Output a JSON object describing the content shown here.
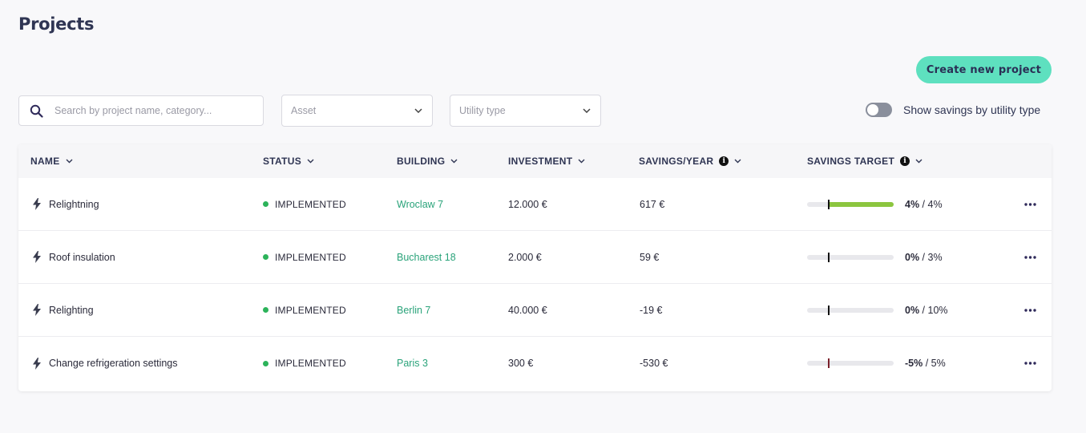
{
  "page": {
    "title": "Projects"
  },
  "toolbar": {
    "create_label": "Create new project",
    "search_placeholder": "Search by project name, category...",
    "asset_placeholder": "Asset",
    "utility_placeholder": "Utility type",
    "toggle_label": "Show savings by utility type",
    "toggle_on": false
  },
  "columns": {
    "name": "NAME",
    "status": "STATUS",
    "building": "BUILDING",
    "investment": "INVESTMENT",
    "savings": "SAVINGS/YEAR",
    "target": "SAVINGS TARGET"
  },
  "rows": [
    {
      "name": "Relightning",
      "status": "IMPLEMENTED",
      "building": "Wroclaw 7",
      "investment": "12.000 €",
      "savings": "617 €",
      "progress": "4%",
      "target": " / 4%",
      "progress_fraction": 1.0,
      "marker_color": "#111111"
    },
    {
      "name": "Roof insulation",
      "status": "IMPLEMENTED",
      "building": "Bucharest 18",
      "investment": "2.000 €",
      "savings": "59 €",
      "progress": "0%",
      "target": " / 3%",
      "progress_fraction": 0,
      "marker_color": "#111111"
    },
    {
      "name": "Relighting",
      "status": "IMPLEMENTED",
      "building": "Berlin 7",
      "investment": "40.000 €",
      "savings": "-19 €",
      "progress": "0%",
      "target": " / 10%",
      "progress_fraction": 0,
      "marker_color": "#111111"
    },
    {
      "name": "Change refrigeration settings",
      "status": "IMPLEMENTED",
      "building": "Paris 3",
      "investment": "300 €",
      "savings": "-530 €",
      "progress": "-5%",
      "target": " / 5%",
      "progress_fraction": 0,
      "marker_color": "#7a1f2a"
    }
  ],
  "colors": {
    "accent": "#5ee0bf",
    "status_implemented": "#2cb35a",
    "building_link": "#2aa37a",
    "progress_fill": "#8cc63f"
  },
  "icons": {
    "search": "search-icon",
    "chevron": "chevron-down-icon",
    "info": "info-icon",
    "bolt": "bolt-icon",
    "more": "more-options-icon"
  }
}
